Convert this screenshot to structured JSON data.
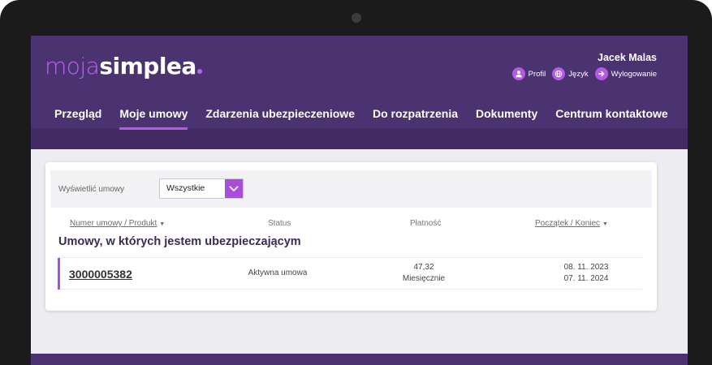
{
  "brand": {
    "part1": "moja",
    "part2": "simplea",
    "accent": "#b766e8",
    "header_bg": "#4b3271"
  },
  "user": {
    "name": "Jacek Malas",
    "links": [
      {
        "label": "Profil",
        "icon": "user-icon"
      },
      {
        "label": "Język",
        "icon": "globe-icon"
      },
      {
        "label": "Wylogowanie",
        "icon": "arrow-right-icon"
      }
    ]
  },
  "nav": {
    "items": [
      "Przegląd",
      "Moje umowy",
      "Zdarzenia ubezpieczeniowe",
      "Do rozpatrzenia",
      "Dokumenty",
      "Centrum kontaktowe"
    ],
    "active_index": 1
  },
  "filter": {
    "label": "Wyświetlić umowy",
    "selected": "Wszystkie"
  },
  "table": {
    "headers": {
      "number": "Numer umowy / Produkt",
      "status": "Status",
      "payment": "Płatność",
      "dates": "Początek / Koniec"
    },
    "section_title": "Umowy, w których jestem ubezpieczającym",
    "rows": [
      {
        "number": "3000005382",
        "status": "Aktywna umowa",
        "amount": "47,32",
        "frequency": "Miesięcznie",
        "start": "08. 11. 2023",
        "end": "07. 11. 2024"
      }
    ]
  }
}
